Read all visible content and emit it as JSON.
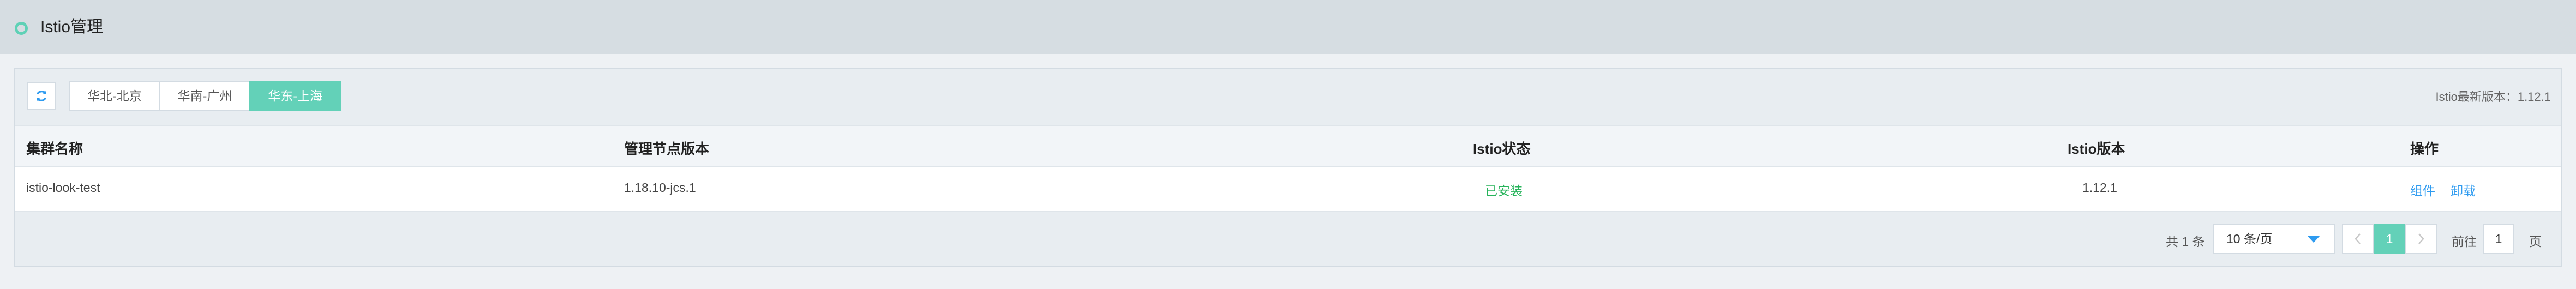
{
  "header": {
    "title": "Istio管理"
  },
  "toolbar": {
    "refresh_icon": "refresh-icon",
    "regions": [
      {
        "label": "华北-北京",
        "active": false
      },
      {
        "label": "华南-广州",
        "active": false
      },
      {
        "label": "华东-上海",
        "active": true
      }
    ],
    "latest_version": "Istio最新版本：1.12.1"
  },
  "table": {
    "columns": [
      "集群名称",
      "管理节点版本",
      "Istio状态",
      "Istio版本",
      "操作"
    ],
    "rows": [
      {
        "cluster": "istio-look-test",
        "node_version": "1.18.10-jcs.1",
        "status": "已安装",
        "istio_version": "1.12.1",
        "actions": [
          "组件",
          "卸载"
        ]
      }
    ]
  },
  "pagination": {
    "total": "共 1 条",
    "page_size": "10 条/页",
    "current_page": "1",
    "goto_label": "前往",
    "goto_value": "1",
    "page_suffix": "页"
  },
  "colors": {
    "accent": "#63d1b8",
    "link": "#2e9bf0",
    "status_ok": "#26b35a"
  }
}
